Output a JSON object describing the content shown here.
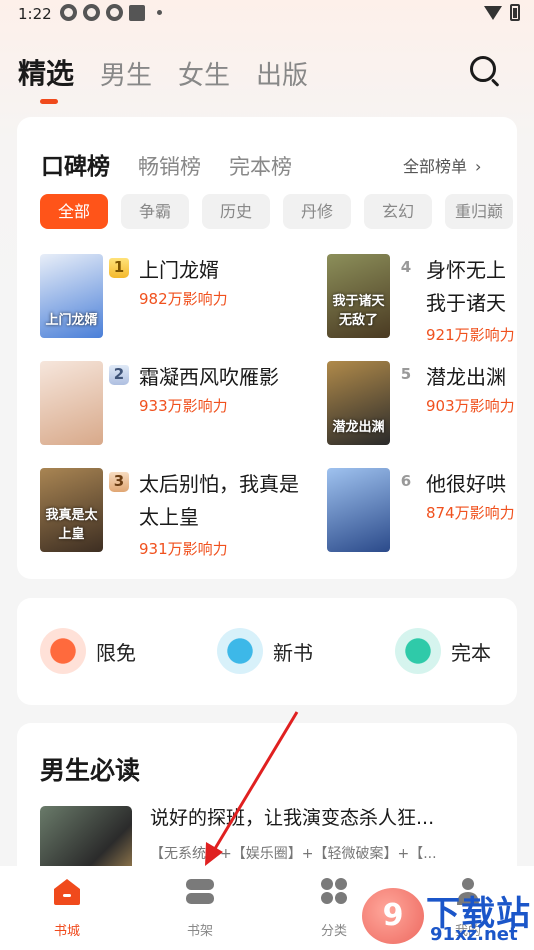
{
  "status_bar": {
    "time": "1:22"
  },
  "top_tabs": [
    "精选",
    "男生",
    "女生",
    "出版"
  ],
  "rank_tabs": [
    "口碑榜",
    "畅销榜",
    "完本榜"
  ],
  "all_rank_label": "全部榜单",
  "chips": [
    "全部",
    "争霸",
    "历史",
    "丹修",
    "玄幻",
    "重归巅"
  ],
  "books": [
    {
      "rank": "1",
      "title": "上门龙婿",
      "heat": "982万影响力",
      "cover_text": "上门龙婿",
      "cover_colors": [
        "#4a7fd8",
        "#e8eef8"
      ]
    },
    {
      "rank": "2",
      "title": "霜凝西风吹雁影",
      "heat": "933万影响力",
      "cover_text": "",
      "cover_colors": [
        "#d8a98a",
        "#f6e6dc"
      ]
    },
    {
      "rank": "3",
      "title": "太后别怕，我真是太上皇",
      "heat": "931万影响力",
      "cover_text": "我真是太上皇",
      "cover_colors": [
        "#3d2e22",
        "#a98553"
      ]
    },
    {
      "rank": "4",
      "title": "身怀无上我于诸天",
      "heat": "921万影响力",
      "cover_text": "我于诸天无敌了",
      "cover_colors": [
        "#4a3a22",
        "#8c8f5a"
      ]
    },
    {
      "rank": "5",
      "title": "潜龙出渊",
      "heat": "903万影响力",
      "cover_text": "潜龙出渊",
      "cover_colors": [
        "#2a2a2a",
        "#b08a4a"
      ]
    },
    {
      "rank": "6",
      "title": "他很好哄",
      "heat": "874万影响力",
      "cover_text": "",
      "cover_colors": [
        "#2b4a8a",
        "#9fc2ef"
      ]
    }
  ],
  "categories": [
    {
      "label": "限免",
      "icon": "stopwatch-icon",
      "color": "#ff6a3d"
    },
    {
      "label": "新书",
      "icon": "new-tag-icon",
      "color": "#3db8e8"
    },
    {
      "label": "完本",
      "icon": "book-icon",
      "color": "#2fcaa9"
    }
  ],
  "male_section": {
    "title": "男生必读",
    "book_title": "说好的探班，让我演变态杀人狂...",
    "book_tags": "【无系统】+【娱乐圈】+【轻微破案】+【..."
  },
  "bottom_nav": [
    {
      "label": "书城",
      "icon": "home-icon"
    },
    {
      "label": "书架",
      "icon": "bookshelf-icon"
    },
    {
      "label": "分类",
      "icon": "category-icon"
    },
    {
      "label": "我的",
      "icon": "profile-icon"
    }
  ],
  "watermark": {
    "text": "下载站",
    "url": "91xz.net",
    "logo": "9"
  },
  "colors": {
    "accent": "#f04a1c",
    "heat": "#f0511e",
    "arrow": "#e02020"
  }
}
